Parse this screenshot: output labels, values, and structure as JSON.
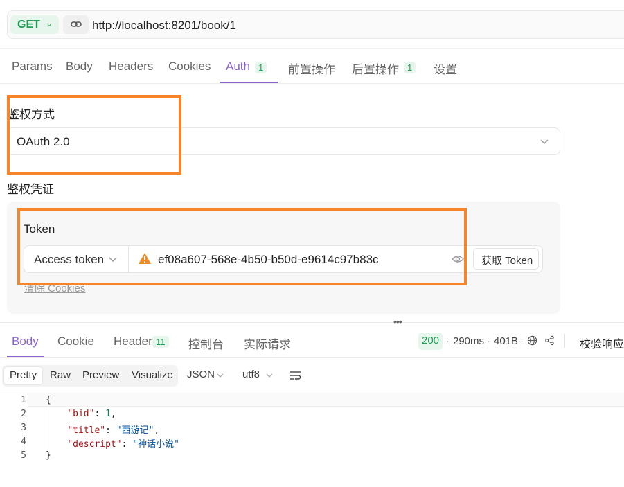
{
  "request": {
    "method": "GET",
    "url": "http://localhost:8201/book/1"
  },
  "tabs": [
    {
      "label": "Params"
    },
    {
      "label": "Body"
    },
    {
      "label": "Headers"
    },
    {
      "label": "Cookies"
    },
    {
      "label": "Auth",
      "badge": "1",
      "active": true
    },
    {
      "label": "前置操作"
    },
    {
      "label": "后置操作",
      "badge": "1"
    },
    {
      "label": "设置"
    }
  ],
  "auth": {
    "method_label": "鉴权方式",
    "method_value": "OAuth 2.0",
    "credentials_label": "鉴权凭证",
    "token_label": "Token",
    "token_type": "Access token",
    "token_value": "ef08a607-568e-4b50-b50d-e9614c97b83c",
    "get_token_button": "获取 Token",
    "clear_cookies": "清除 Cookies"
  },
  "response": {
    "tabs": [
      {
        "label": "Body",
        "active": true
      },
      {
        "label": "Cookie"
      },
      {
        "label": "Header",
        "badge": "11"
      },
      {
        "label": "控制台"
      },
      {
        "label": "实际请求"
      }
    ],
    "status": "200",
    "time": "290ms",
    "size": "401B",
    "validate_label": "校验响应",
    "view_modes": [
      "Pretty",
      "Raw",
      "Preview",
      "Visualize"
    ],
    "format": "JSON",
    "encoding": "utf8",
    "line_numbers": [
      "1",
      "2",
      "3",
      "4",
      "5"
    ],
    "body": {
      "bid_key": "\"bid\"",
      "bid_val": "1",
      "title_key": "\"title\"",
      "title_val": "\"西游记\"",
      "descript_key": "\"descript\"",
      "descript_val": "\"神话小说\""
    }
  },
  "colors": {
    "accent": "#8a63d2",
    "get_green": "#1f9d55",
    "highlight": "#f5842b",
    "warning": "#f08a24"
  }
}
